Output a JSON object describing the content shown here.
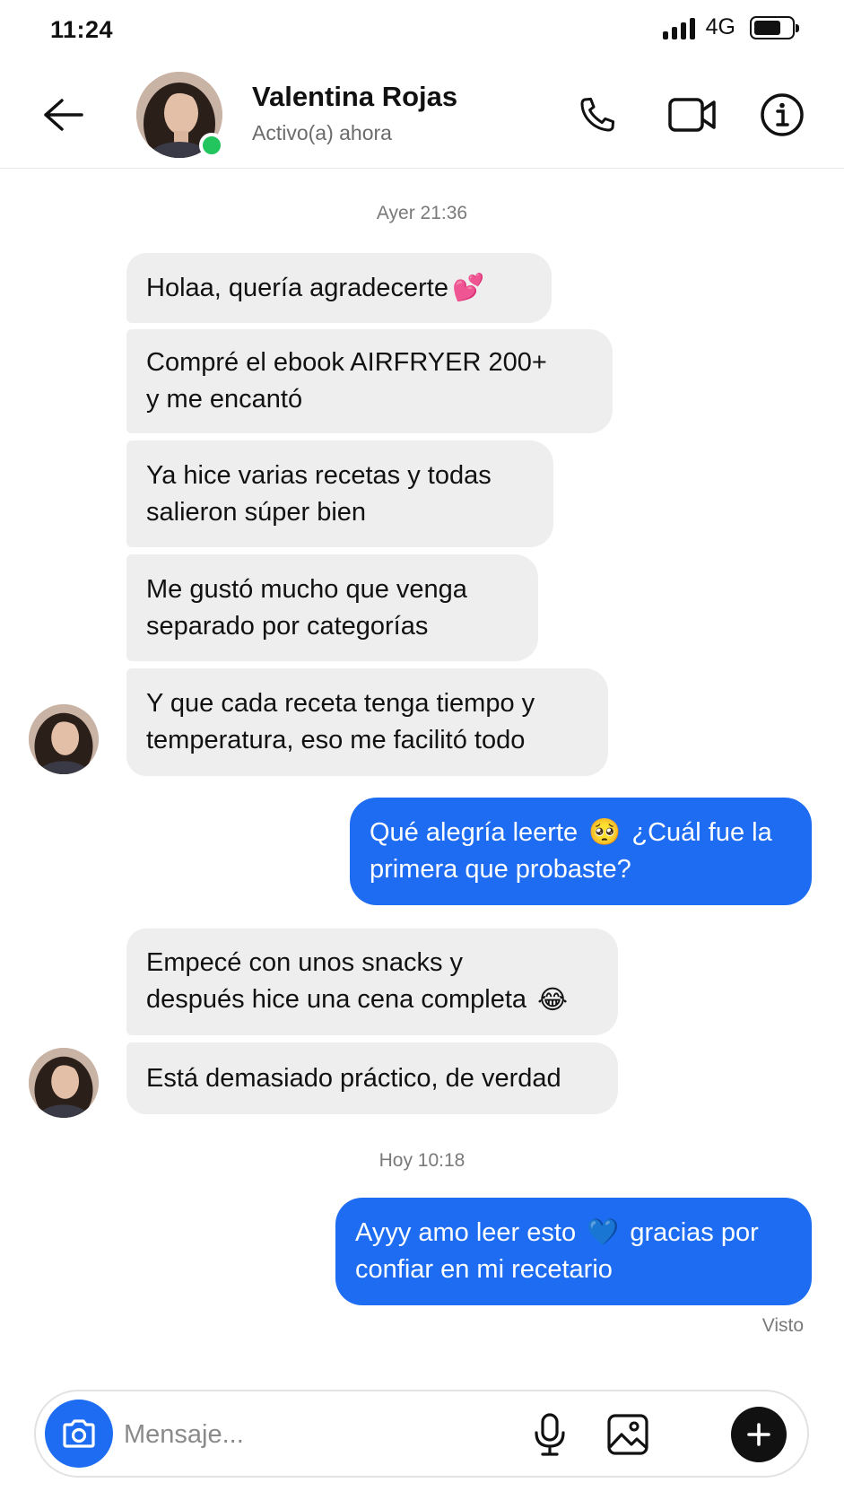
{
  "status_bar": {
    "time": "11:24",
    "network": "4G"
  },
  "header": {
    "contact_name": "Valentina Rojas",
    "contact_status": "Activo(a) ahora",
    "icons": [
      "back-arrow-icon",
      "phone-icon",
      "video-icon",
      "info-icon"
    ]
  },
  "chat": {
    "timestamp_1": "Ayer 21:36",
    "timestamp_2": "Hoy 10:18",
    "messages": [
      {
        "from": "contact",
        "lines": [
          "Holaa, quería agradecerte"
        ],
        "emoji": "💕"
      },
      {
        "from": "contact",
        "lines": [
          "Compré el ebook AIRFRYER 200+",
          "y me encantó"
        ]
      },
      {
        "from": "contact",
        "lines": [
          "Ya hice varias recetas y todas",
          "salieron súper bien"
        ]
      },
      {
        "from": "contact",
        "lines": [
          "Me gustó mucho que venga",
          "separado por categorías"
        ]
      },
      {
        "from": "contact",
        "lines": [
          "Y que cada receta tenga tiempo y",
          "temperatura, eso me facilitó todo"
        ]
      },
      {
        "from": "me",
        "lines": [
          "Qué alegría leerte",
          "¿Cuál fue la",
          "primera que probaste?"
        ],
        "emoji": "🥺"
      },
      {
        "from": "contact",
        "lines": [
          "Empecé con unos snacks y",
          "después hice una cena completa"
        ],
        "emoji": "😂"
      },
      {
        "from": "contact",
        "lines": [
          "Está demasiado práctico, de verdad"
        ]
      },
      {
        "from": "me",
        "lines": [
          "Ayyy amo leer esto",
          "gracias por",
          "confiar en mi recetario"
        ],
        "emoji": "💙"
      }
    ],
    "seen_label": "Visto"
  },
  "composer": {
    "placeholder": "Mensaje...",
    "icons": [
      "camera-icon",
      "microphone-icon",
      "image-icon",
      "plus-icon"
    ]
  },
  "colors": {
    "accent": "#1d6cf2",
    "incoming_bubble": "#eeeeef",
    "online": "#22c55e"
  }
}
